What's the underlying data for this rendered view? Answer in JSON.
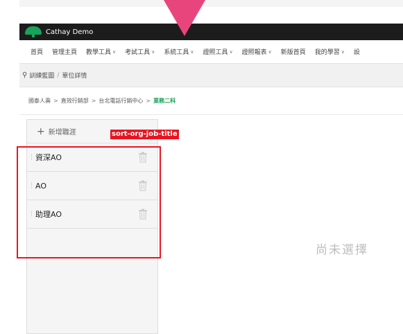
{
  "brand": {
    "name": "Cathay Demo"
  },
  "nav": {
    "items": [
      {
        "label": "首頁",
        "has_menu": false
      },
      {
        "label": "管理主頁",
        "has_menu": false
      },
      {
        "label": "教學工具",
        "has_menu": true
      },
      {
        "label": "考試工具",
        "has_menu": true
      },
      {
        "label": "系統工具",
        "has_menu": true
      },
      {
        "label": "證照工具",
        "has_menu": true
      },
      {
        "label": "證照報表",
        "has_menu": true
      },
      {
        "label": "新版首頁",
        "has_menu": false
      },
      {
        "label": "我的學習",
        "has_menu": true
      },
      {
        "label": "設",
        "has_menu": false
      }
    ]
  },
  "breadcrumb": {
    "section": "訓練藍圖",
    "separator": "/",
    "page": "單位詳情"
  },
  "org_path": {
    "items": [
      "國泰人壽",
      "直效行銷部",
      "台北電話行銷中心"
    ],
    "separator": ">",
    "current": "業務二科"
  },
  "sidebar": {
    "add_label": "新增職涯",
    "items": [
      {
        "label": "資深AO"
      },
      {
        "label": "AO"
      },
      {
        "label": "助理AO"
      }
    ]
  },
  "main": {
    "empty_text": "尚未選擇"
  },
  "annotation": {
    "label": "sort-org-job-title"
  },
  "colors": {
    "brand_bar": "#1c1c1c",
    "logo_green": "#19a25a",
    "current_crumb": "#19a25a",
    "highlight": "#e8151f",
    "pointer": "#e8457c"
  }
}
